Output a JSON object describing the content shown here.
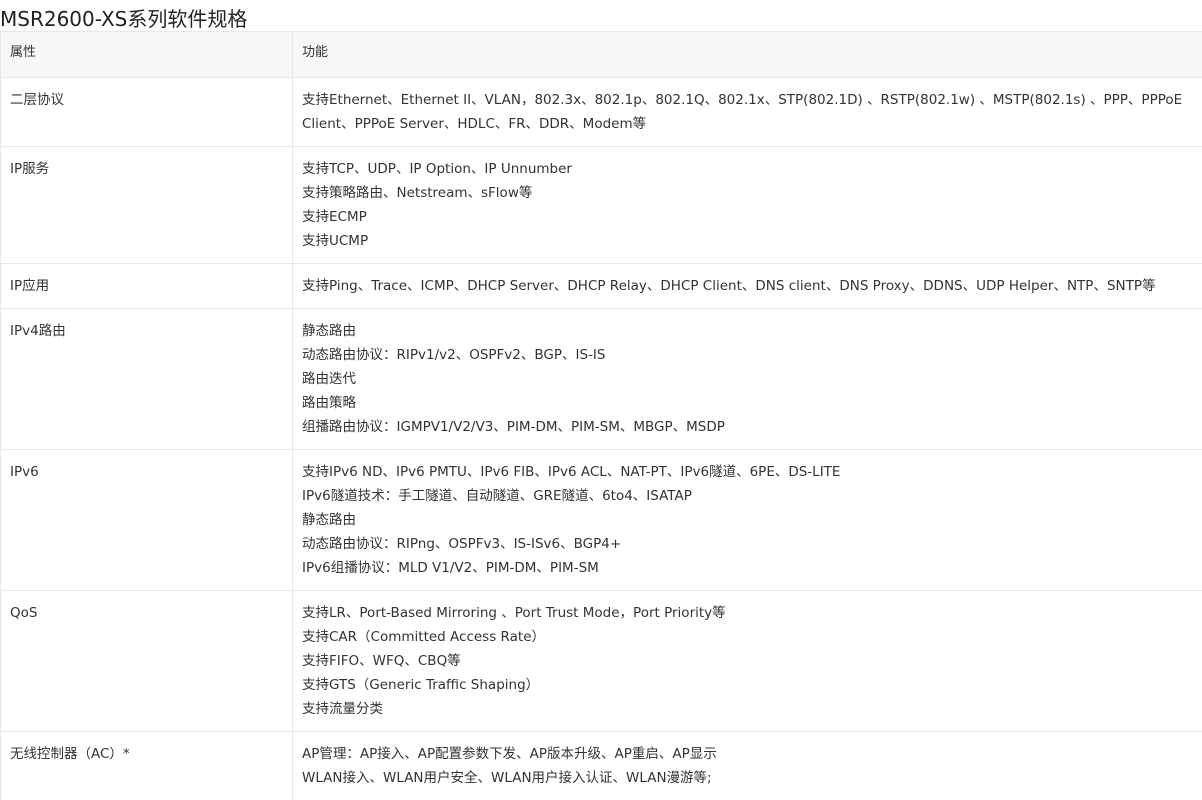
{
  "page": {
    "title": "MSR2600-XS系列软件规格"
  },
  "table": {
    "headers": [
      "属性",
      "功能"
    ],
    "rows": [
      {
        "attribute": "二层协议",
        "lines": [
          "支持Ethernet、Ethernet II、VLAN，802.3x、802.1p、802.1Q、802.1x、STP(802.1D) 、RSTP(802.1w) 、MSTP(802.1s) 、PPP、PPPoE Client、PPPoE Server、HDLC、FR、DDR、Modem等"
        ]
      },
      {
        "attribute": "IP服务",
        "lines": [
          "支持TCP、UDP、IP Option、IP Unnumber",
          "支持策略路由、Netstream、sFlow等",
          "支持ECMP",
          "支持UCMP"
        ]
      },
      {
        "attribute": "IP应用",
        "lines": [
          "支持Ping、Trace、ICMP、DHCP Server、DHCP Relay、DHCP Client、DNS client、DNS Proxy、DDNS、UDP Helper、NTP、SNTP等"
        ]
      },
      {
        "attribute": "IPv4路由",
        "lines": [
          "静态路由",
          "动态路由协议：RIPv1/v2、OSPFv2、BGP、IS-IS",
          "路由迭代",
          "路由策略",
          "组播路由协议：IGMPV1/V2/V3、PIM-DM、PIM-SM、MBGP、MSDP"
        ]
      },
      {
        "attribute": "IPv6",
        "lines": [
          "支持IPv6 ND、IPv6 PMTU、IPv6 FIB、IPv6 ACL、NAT-PT、IPv6隧道、6PE、DS-LITE",
          "IPv6隧道技术：手工隧道、自动隧道、GRE隧道、6to4、ISATAP",
          "静态路由",
          "动态路由协议：RIPng、OSPFv3、IS-ISv6、BGP4+",
          "IPv6组播协议：MLD V1/V2、PIM-DM、PIM-SM"
        ]
      },
      {
        "attribute": "QoS",
        "lines": [
          "支持LR、Port-Based Mirroring 、Port Trust Mode，Port Priority等",
          "支持CAR（Committed Access Rate）",
          "支持FIFO、WFQ、CBQ等",
          "支持GTS（Generic Traffic Shaping）",
          "支持流量分类"
        ]
      },
      {
        "attribute": "无线控制器（AC）*",
        "lines": [
          "AP管理：AP接入、AP配置参数下发、AP版本升级、AP重启、AP显示",
          "WLAN接入、WLAN用户安全、WLAN用户接入认证、WLAN漫游等;"
        ]
      }
    ]
  }
}
